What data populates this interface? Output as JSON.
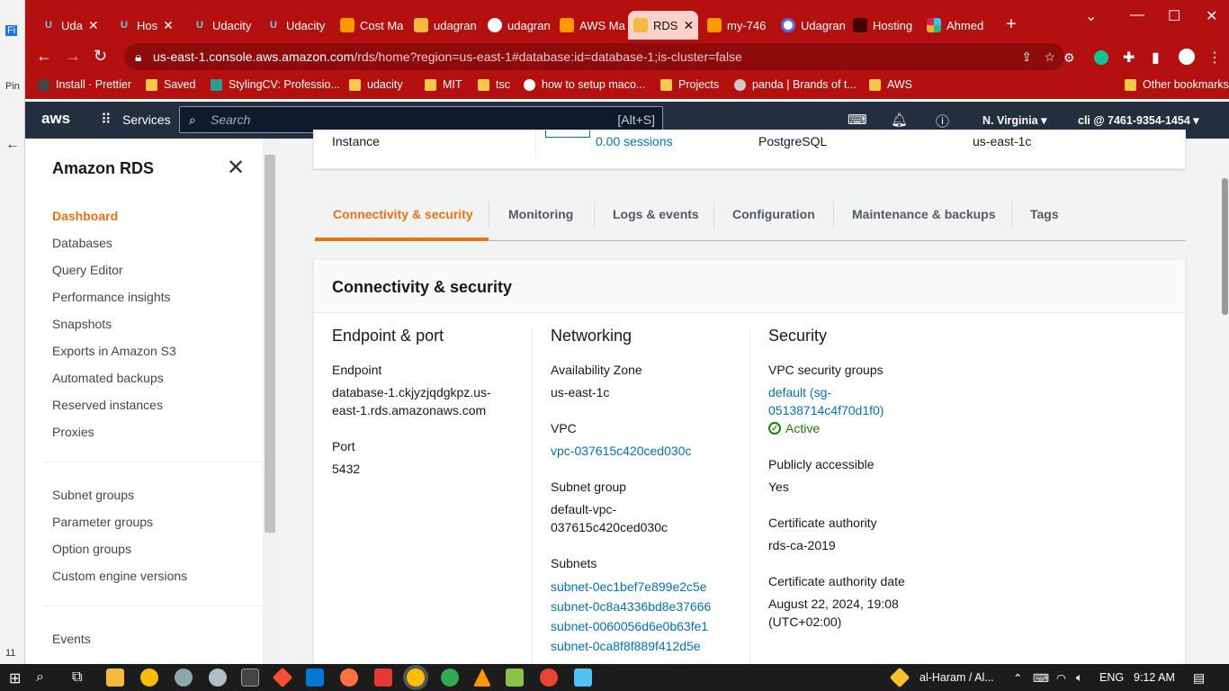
{
  "left_app": {
    "t1": "Fi",
    "t2": "Pin",
    "t3": "11"
  },
  "browser": {
    "tabs": [
      {
        "label": "Uda",
        "icon": "udacity-icon"
      },
      {
        "label": "Hos",
        "icon": "udacity-icon"
      },
      {
        "label": "Udacity",
        "icon": "udacity-icon"
      },
      {
        "label": "Udacity",
        "icon": "udacity-icon"
      },
      {
        "label": "Cost Ma",
        "icon": "aws-cube-icon"
      },
      {
        "label": "udagran",
        "icon": "aws-box-icon"
      },
      {
        "label": "udagran",
        "icon": "github-icon"
      },
      {
        "label": "AWS Ma",
        "icon": "aws-cube-icon"
      },
      {
        "label": "RDS",
        "icon": "aws-box-icon"
      },
      {
        "label": "my-746",
        "icon": "aws-cube-icon"
      },
      {
        "label": "Udagran",
        "icon": "circle-icon"
      },
      {
        "label": "Hosting",
        "icon": "dark-icon"
      },
      {
        "label": "Ahmed",
        "icon": "slack-icon"
      }
    ],
    "url_host": "us-east-1.console.aws.amazon.com",
    "url_path": "/rds/home?region=us-east-1#database:id=database-1;is-cluster=false",
    "bookmarks": [
      "Install · Prettier",
      "Saved",
      "StylingCV: Professio...",
      "udacity",
      "MIT",
      "tsc",
      "how to setup maco...",
      "Projects",
      "panda | Brands of t...",
      "AWS"
    ],
    "other_bookmarks": "Other bookmarks"
  },
  "aws": {
    "logo": "aws",
    "services": "Services",
    "search_placeholder": "Search",
    "search_shortcut": "[Alt+S]",
    "region": "N. Virginia",
    "account": "cli @ 7461-9354-1454"
  },
  "sidebar": {
    "title": "Amazon RDS",
    "items": [
      "Dashboard",
      "Databases",
      "Query Editor",
      "Performance insights",
      "Snapshots",
      "Exports in Amazon S3",
      "Automated backups",
      "Reserved instances",
      "Proxies"
    ],
    "items2": [
      "Subnet groups",
      "Parameter groups",
      "Option groups",
      "Custom engine versions"
    ],
    "items3": [
      "Events"
    ]
  },
  "summary": {
    "c1": "Instance",
    "c2": "0.00 sessions",
    "c3": "PostgreSQL",
    "c4": "us-east-1c"
  },
  "tabs": [
    "Connectivity & security",
    "Monitoring",
    "Logs & events",
    "Configuration",
    "Maintenance & backups",
    "Tags"
  ],
  "card": {
    "title": "Connectivity & security",
    "endpoint_port": {
      "heading": "Endpoint & port",
      "endpoint_label": "Endpoint",
      "endpoint_l1": "database-1.ckjyzjqdgkpz.us-",
      "endpoint_l2": "east-1.rds.amazonaws.com",
      "port_label": "Port",
      "port": "5432"
    },
    "networking": {
      "heading": "Networking",
      "az_label": "Availability Zone",
      "az": "us-east-1c",
      "vpc_label": "VPC",
      "vpc": "vpc-037615c420ced030c",
      "subnet_group_label": "Subnet group",
      "subnet_group_l1": "default-vpc-",
      "subnet_group_l2": "037615c420ced030c",
      "subnets_label": "Subnets",
      "subnets": [
        "subnet-0ec1bef7e899e2c5e",
        "subnet-0c8a4336bd8e37666",
        "subnet-0060056d6e0b63fe1",
        "subnet-0ca8f8f889f412d5e"
      ]
    },
    "security": {
      "heading": "Security",
      "sg_label": "VPC security groups",
      "sg_l1": "default (sg-",
      "sg_l2": "05138714c4f70d1f0)",
      "sg_status": "Active",
      "public_label": "Publicly accessible",
      "public": "Yes",
      "ca_label": "Certificate authority",
      "ca": "rds-ca-2019",
      "ca_date_label": "Certificate authority date",
      "ca_date_l1": "August 22, 2024, 19:08",
      "ca_date_l2": "(UTC+02:00)"
    }
  },
  "taskbar": {
    "media": "al-Haram / Al...",
    "lang": "ENG",
    "time": "9:12 AM"
  }
}
